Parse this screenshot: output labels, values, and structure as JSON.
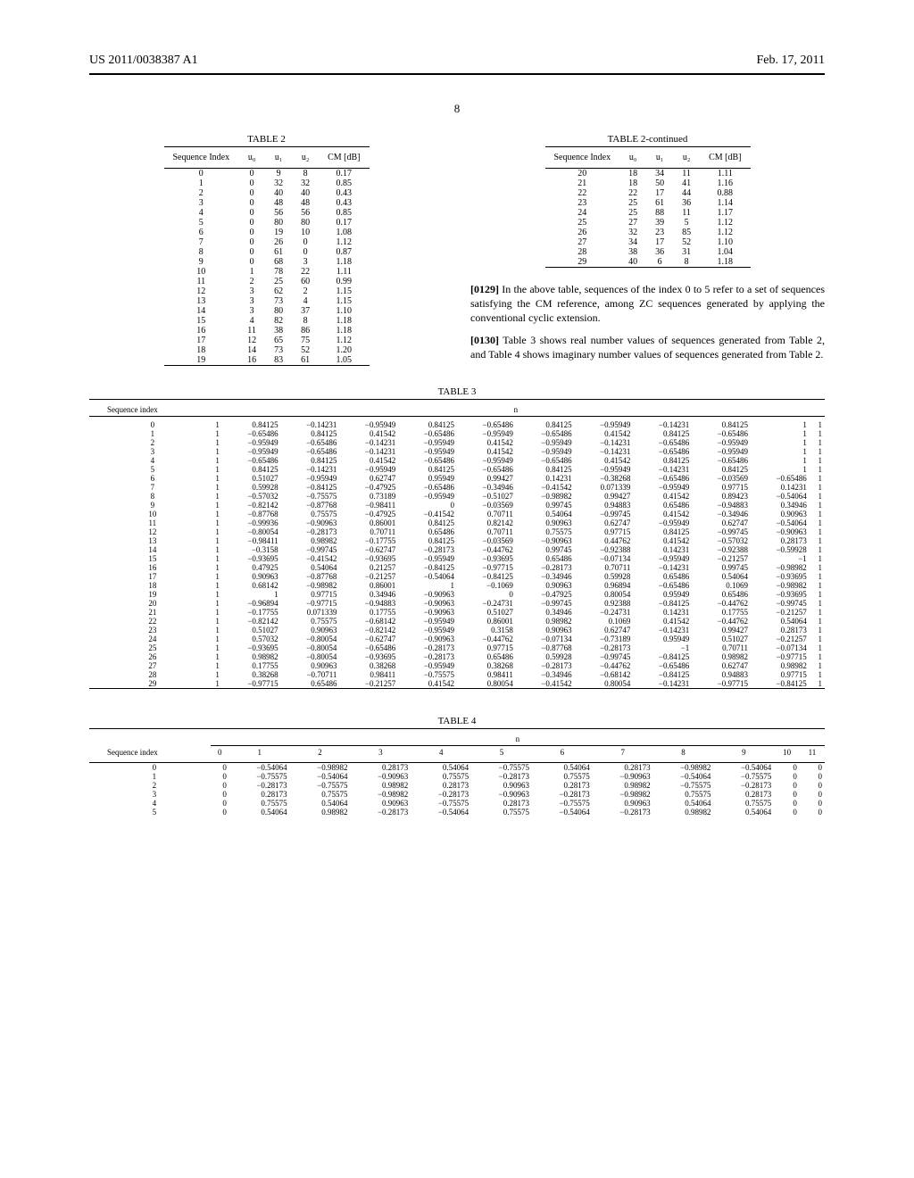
{
  "header": {
    "left": "US 2011/0038387 A1",
    "right": "Feb. 17, 2011"
  },
  "page_number": "8",
  "table2": {
    "title": "TABLE 2",
    "cols": [
      "Sequence Index",
      "u₀",
      "u₁",
      "u₂",
      "CM [dB]"
    ],
    "rows": [
      [
        0,
        0,
        9,
        8,
        "0.17"
      ],
      [
        1,
        0,
        32,
        32,
        "0.85"
      ],
      [
        2,
        0,
        40,
        40,
        "0.43"
      ],
      [
        3,
        0,
        48,
        48,
        "0.43"
      ],
      [
        4,
        0,
        56,
        56,
        "0.85"
      ],
      [
        5,
        0,
        80,
        80,
        "0.17"
      ],
      [
        6,
        0,
        19,
        10,
        "1.08"
      ],
      [
        7,
        0,
        26,
        0,
        "1.12"
      ],
      [
        8,
        0,
        61,
        0,
        "0.87"
      ],
      [
        9,
        0,
        68,
        3,
        "1.18"
      ],
      [
        10,
        1,
        78,
        22,
        "1.11"
      ],
      [
        11,
        2,
        25,
        60,
        "0.99"
      ],
      [
        12,
        3,
        62,
        2,
        "1.15"
      ],
      [
        13,
        3,
        73,
        4,
        "1.15"
      ],
      [
        14,
        3,
        80,
        37,
        "1.10"
      ],
      [
        15,
        4,
        82,
        8,
        "1.18"
      ],
      [
        16,
        11,
        38,
        86,
        "1.18"
      ],
      [
        17,
        12,
        65,
        75,
        "1.12"
      ],
      [
        18,
        14,
        73,
        52,
        "1.20"
      ],
      [
        19,
        16,
        83,
        61,
        "1.05"
      ]
    ]
  },
  "table2c": {
    "title": "TABLE 2-continued",
    "cols": [
      "Sequence Index",
      "u₀",
      "u₁",
      "u₂",
      "CM [dB]"
    ],
    "rows": [
      [
        20,
        18,
        34,
        11,
        "1.11"
      ],
      [
        21,
        18,
        50,
        41,
        "1.16"
      ],
      [
        22,
        22,
        17,
        44,
        "0.88"
      ],
      [
        23,
        25,
        61,
        36,
        "1.14"
      ],
      [
        24,
        25,
        88,
        11,
        "1.17"
      ],
      [
        25,
        27,
        39,
        5,
        "1.12"
      ],
      [
        26,
        32,
        23,
        85,
        "1.12"
      ],
      [
        27,
        34,
        17,
        52,
        "1.10"
      ],
      [
        28,
        38,
        36,
        31,
        "1.04"
      ],
      [
        29,
        40,
        6,
        8,
        "1.18"
      ]
    ]
  },
  "para1": {
    "num": "[0129]",
    "text": "   In the above table, sequences of the index 0 to 5 refer to a set of sequences satisfying the CM reference, among ZC sequences generated by applying the conventional cyclic extension."
  },
  "para2": {
    "num": "[0130]",
    "text": "   Table 3 shows real number values of sequences generated from Table 2, and Table 4 shows imaginary number values of sequences generated from Table 2."
  },
  "table3": {
    "title": "TABLE 3",
    "head_left": "Sequence index",
    "head_group": "n",
    "rows": [
      [
        0,
        1,
        "0.84125",
        "−0.14231",
        "−0.95949",
        "0.84125",
        "−0.65486",
        "0.84125",
        "−0.95949",
        "−0.14231",
        "0.84125",
        "1",
        "1"
      ],
      [
        1,
        1,
        "−0.65486",
        "0.84125",
        "0.41542",
        "−0.65486",
        "−0.95949",
        "−0.65486",
        "0.41542",
        "0.84125",
        "−0.65486",
        "1",
        "1"
      ],
      [
        2,
        1,
        "−0.95949",
        "−0.65486",
        "−0.14231",
        "−0.95949",
        "0.41542",
        "−0.95949",
        "−0.14231",
        "−0.65486",
        "−0.95949",
        "1",
        "1"
      ],
      [
        3,
        1,
        "−0.95949",
        "−0.65486",
        "−0.14231",
        "−0.95949",
        "0.41542",
        "−0.95949",
        "−0.14231",
        "−0.65486",
        "−0.95949",
        "1",
        "1"
      ],
      [
        4,
        1,
        "−0.65486",
        "0.84125",
        "0.41542",
        "−0.65486",
        "−0.95949",
        "−0.65486",
        "0.41542",
        "0.84125",
        "−0.65486",
        "1",
        "1"
      ],
      [
        5,
        1,
        "0.84125",
        "−0.14231",
        "−0.95949",
        "0.84125",
        "−0.65486",
        "0.84125",
        "−0.95949",
        "−0.14231",
        "0.84125",
        "1",
        "1"
      ],
      [
        6,
        1,
        "0.51027",
        "−0.95949",
        "0.62747",
        "0.95949",
        "0.99427",
        "0.14231",
        "−0.38268",
        "−0.65486",
        "−0.03569",
        "−0.65486",
        "1"
      ],
      [
        7,
        1,
        "0.59928",
        "−0.84125",
        "−0.47925",
        "−0.65486",
        "−0.34946",
        "−0.41542",
        "0.071339",
        "−0.95949",
        "0.97715",
        "0.14231",
        "1"
      ],
      [
        8,
        1,
        "−0.57032",
        "−0.75575",
        "0.73189",
        "−0.95949",
        "−0.51027",
        "−0.98982",
        "0.99427",
        "0.41542",
        "0.89423",
        "−0.54064",
        "1"
      ],
      [
        9,
        1,
        "−0.82142",
        "−0.87768",
        "−0.98411",
        "0",
        "−0.03569",
        "0.99745",
        "0.94883",
        "0.65486",
        "−0.94883",
        "0.34946",
        "1"
      ],
      [
        10,
        1,
        "−0.87768",
        "0.75575",
        "−0.47925",
        "−0.41542",
        "0.70711",
        "0.54064",
        "−0.99745",
        "0.41542",
        "−0.34946",
        "0.90963",
        "1"
      ],
      [
        11,
        1,
        "−0.99936",
        "−0.90963",
        "0.86001",
        "0.84125",
        "0.82142",
        "0.90963",
        "0.62747",
        "−0.95949",
        "0.62747",
        "−0.54064",
        "1"
      ],
      [
        12,
        1,
        "−0.80054",
        "−0.28173",
        "0.70711",
        "0.65486",
        "0.70711",
        "0.75575",
        "0.97715",
        "0.84125",
        "−0.99745",
        "−0.90963",
        "1"
      ],
      [
        13,
        1,
        "−0.98411",
        "0.98982",
        "−0.17755",
        "0.84125",
        "−0.03569",
        "−0.90963",
        "0.44762",
        "0.41542",
        "−0.57032",
        "0.28173",
        "1"
      ],
      [
        14,
        1,
        "−0.3158",
        "−0.99745",
        "−0.62747",
        "−0.28173",
        "−0.44762",
        "0.99745",
        "−0.92388",
        "0.14231",
        "−0.92388",
        "−0.59928",
        "1"
      ],
      [
        15,
        1,
        "−0.93695",
        "−0.41542",
        "−0.93695",
        "−0.95949",
        "−0.93695",
        "0.65486",
        "−0.07134",
        "−0.95949",
        "−0.21257",
        "−1",
        "1"
      ],
      [
        16,
        1,
        "0.47925",
        "0.54064",
        "0.21257",
        "−0.84125",
        "−0.97715",
        "−0.28173",
        "0.70711",
        "−0.14231",
        "0.99745",
        "−0.98982",
        "1"
      ],
      [
        17,
        1,
        "0.90963",
        "−0.87768",
        "−0.21257",
        "−0.54064",
        "−0.84125",
        "−0.34946",
        "0.59928",
        "0.65486",
        "0.54064",
        "−0.93695",
        "1"
      ],
      [
        18,
        1,
        "0.68142",
        "−0.98982",
        "0.86001",
        "1",
        "−0.1069",
        "0.90963",
        "0.96894",
        "−0.65486",
        "0.1069",
        "−0.98982",
        "1"
      ],
      [
        19,
        1,
        "1",
        "0.97715",
        "0.34946",
        "−0.90963",
        "0",
        "−0.47925",
        "0.80054",
        "0.95949",
        "0.65486",
        "−0.93695",
        "1"
      ],
      [
        20,
        1,
        "−0.96894",
        "−0.97715",
        "−0.94883",
        "−0.90963",
        "−0.24731",
        "−0.99745",
        "0.92388",
        "−0.84125",
        "−0.44762",
        "−0.99745",
        "1"
      ],
      [
        21,
        1,
        "−0.17755",
        "0.071339",
        "0.17755",
        "−0.90963",
        "0.51027",
        "0.34946",
        "−0.24731",
        "0.14231",
        "0.17755",
        "−0.21257",
        "1"
      ],
      [
        22,
        1,
        "−0.82142",
        "0.75575",
        "−0.68142",
        "−0.95949",
        "0.86001",
        "0.98982",
        "0.1069",
        "0.41542",
        "−0.44762",
        "0.54064",
        "1"
      ],
      [
        23,
        1,
        "0.51027",
        "0.90963",
        "−0.82142",
        "−0.95949",
        "0.3158",
        "0.90963",
        "0.62747",
        "−0.14231",
        "0.99427",
        "0.28173",
        "1"
      ],
      [
        24,
        1,
        "0.57032",
        "−0.80054",
        "−0.62747",
        "−0.90963",
        "−0.44762",
        "−0.07134",
        "−0.73189",
        "0.95949",
        "0.51027",
        "−0.21257",
        "1"
      ],
      [
        25,
        1,
        "−0.93695",
        "−0.80054",
        "−0.65486",
        "−0.28173",
        "0.97715",
        "−0.87768",
        "−0.28173",
        "−1",
        "0.70711",
        "−0.07134",
        "1"
      ],
      [
        26,
        1,
        "0.98982",
        "−0.80054",
        "−0.93695",
        "−0.28173",
        "0.65486",
        "0.59928",
        "−0.99745",
        "−0.84125",
        "0.98982",
        "−0.97715",
        "1"
      ],
      [
        27,
        1,
        "0.17755",
        "0.90963",
        "0.38268",
        "−0.95949",
        "0.38268",
        "−0.28173",
        "−0.44762",
        "−0.65486",
        "0.62747",
        "0.98982",
        "1"
      ],
      [
        28,
        1,
        "0.38268",
        "−0.70711",
        "0.98411",
        "−0.75575",
        "0.98411",
        "−0.34946",
        "−0.68142",
        "−0.84125",
        "0.94883",
        "0.97715",
        "1"
      ],
      [
        29,
        1,
        "−0.97715",
        "0.65486",
        "−0.21257",
        "0.41542",
        "0.80054",
        "−0.41542",
        "0.80054",
        "−0.14231",
        "−0.97715",
        "−0.84125",
        "1"
      ]
    ]
  },
  "table4": {
    "title": "TABLE 4",
    "head_left": "Sequence index",
    "head_group": "n",
    "col_nums": [
      "0",
      "1",
      "2",
      "3",
      "4",
      "5",
      "6",
      "7",
      "8",
      "9",
      "10",
      "11"
    ],
    "rows": [
      [
        0,
        0,
        "−0.54064",
        "−0.98982",
        "0.28173",
        "0.54064",
        "−0.75575",
        "0.54064",
        "0.28173",
        "−0.98982",
        "−0.54064",
        0,
        0
      ],
      [
        1,
        0,
        "−0.75575",
        "−0.54064",
        "−0.90963",
        "0.75575",
        "−0.28173",
        "0.75575",
        "−0.90963",
        "−0.54064",
        "−0.75575",
        0,
        0
      ],
      [
        2,
        0,
        "−0.28173",
        "−0.75575",
        "0.98982",
        "0.28173",
        "0.90963",
        "0.28173",
        "0.98982",
        "−0.75575",
        "−0.28173",
        0,
        0
      ],
      [
        3,
        0,
        "0.28173",
        "0.75575",
        "−0.98982",
        "−0.28173",
        "−0.90963",
        "−0.28173",
        "−0.98982",
        "0.75575",
        "0.28173",
        0,
        0
      ],
      [
        4,
        0,
        "0.75575",
        "0.54064",
        "0.90963",
        "−0.75575",
        "0.28173",
        "−0.75575",
        "0.90963",
        "0.54064",
        "0.75575",
        0,
        0
      ],
      [
        5,
        0,
        "0.54064",
        "0.98982",
        "−0.28173",
        "−0.54064",
        "0.75575",
        "−0.54064",
        "−0.28173",
        "0.98982",
        "0.54064",
        0,
        0
      ]
    ]
  }
}
